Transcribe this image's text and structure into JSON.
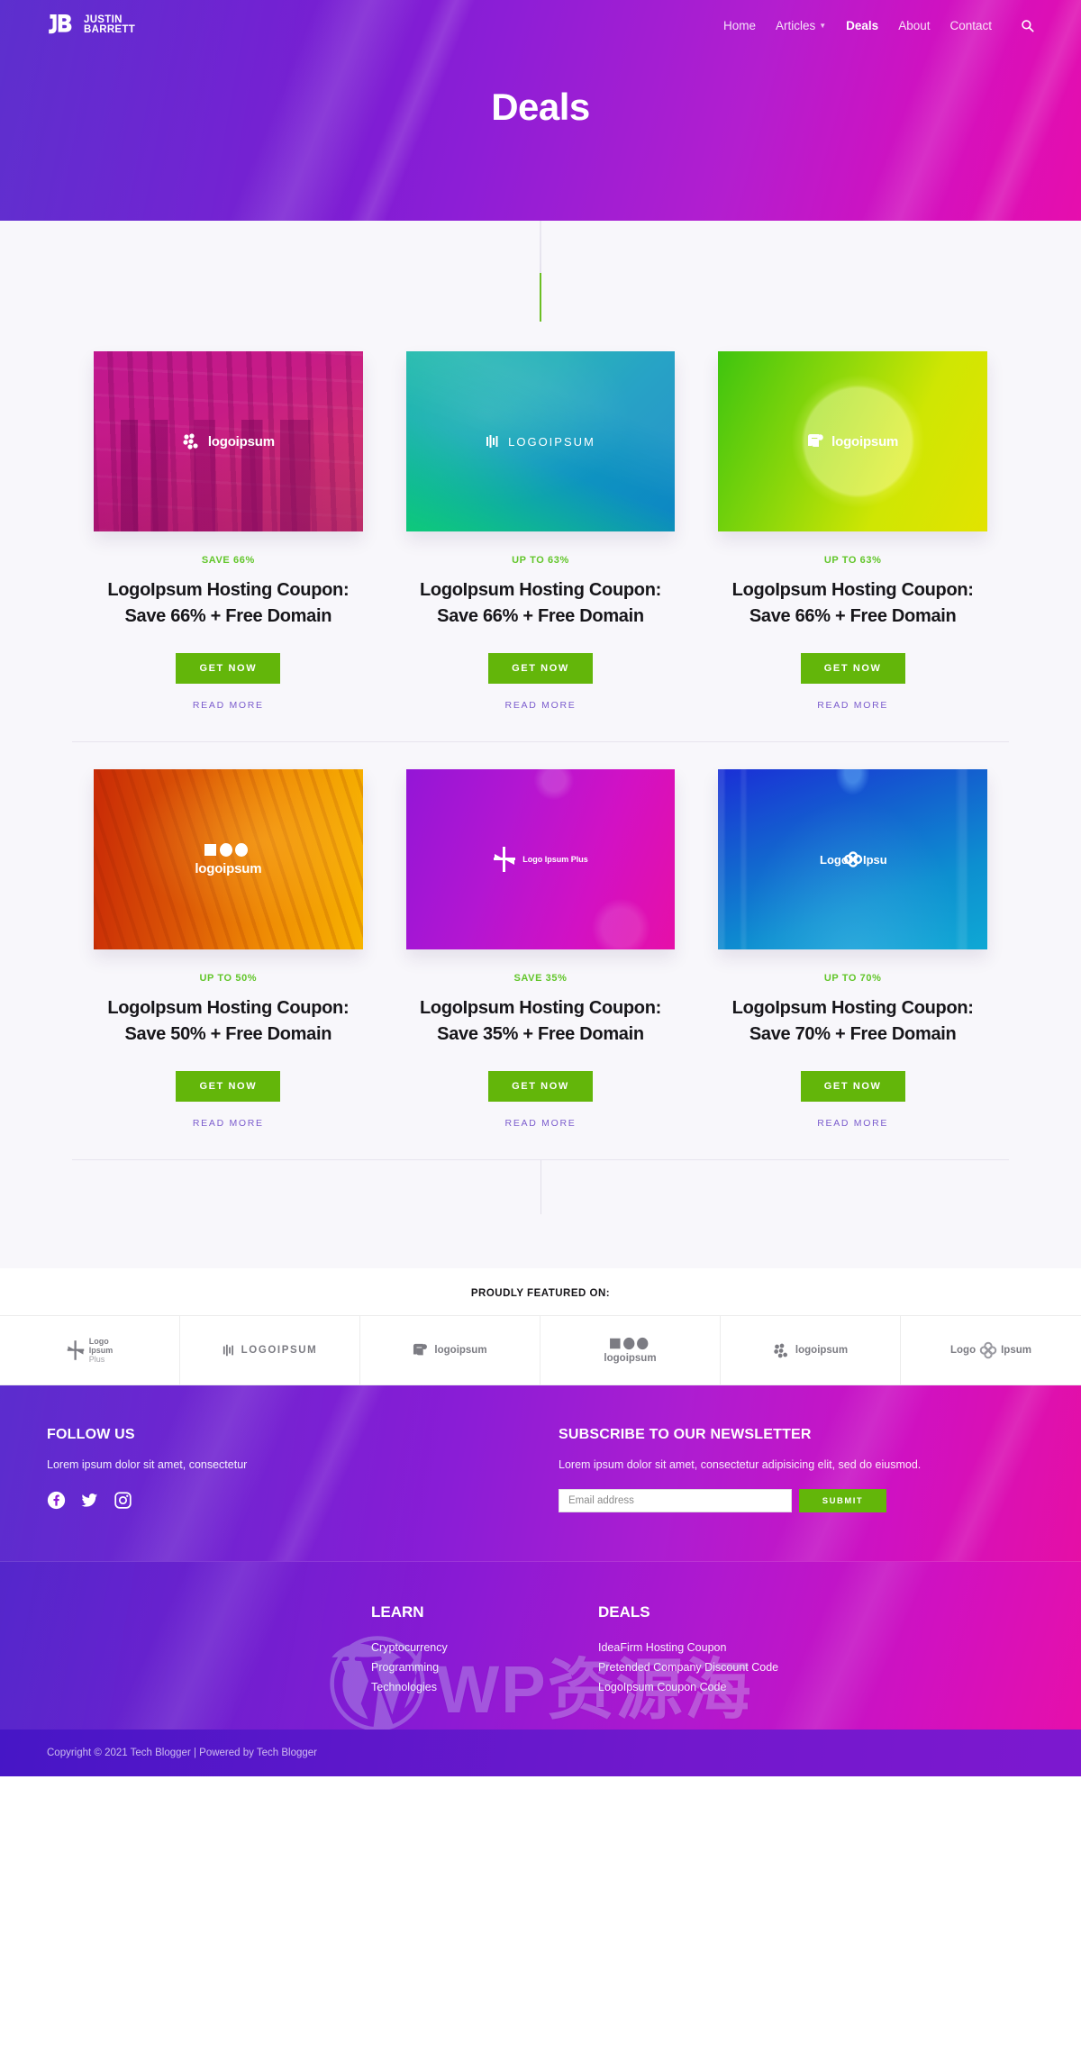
{
  "header": {
    "brand": {
      "mark": "jb-monogram-icon",
      "line1": "JUSTIN",
      "line2": "BARRETT"
    },
    "nav": [
      {
        "label": "Home",
        "active": false,
        "has_caret": false
      },
      {
        "label": "Articles",
        "active": false,
        "has_caret": true
      },
      {
        "label": "Deals",
        "active": true,
        "has_caret": false
      },
      {
        "label": "About",
        "active": false,
        "has_caret": false
      },
      {
        "label": "Contact",
        "active": false,
        "has_caret": false
      }
    ],
    "search_icon": "search-icon",
    "page_title": "Deals"
  },
  "colors": {
    "accent_green": "#63b60a",
    "badge_green": "#62c62a",
    "read_more_purple": "#7b5ccd",
    "brand_purple": "#6a1acf",
    "brand_magenta": "#e60fa6"
  },
  "deals": [
    {
      "badge": "SAVE 66%",
      "title": "LogoIpsum Hosting Coupon: Save 66% + Free Domain",
      "cta": "GET NOW",
      "read_more": "READ MORE",
      "thumb_logo": "logoipsum",
      "thumb_theme": "magenta-city"
    },
    {
      "badge": "UP TO 63%",
      "title": "LogoIpsum Hosting Coupon: Save 66% + Free Domain",
      "cta": "GET NOW",
      "read_more": "READ MORE",
      "thumb_logo": "LOGOIPSUM",
      "thumb_theme": "teal-mountain"
    },
    {
      "badge": "UP TO 63%",
      "title": "LogoIpsum Hosting Coupon: Save 66% + Free Domain",
      "cta": "GET NOW",
      "read_more": "READ MORE",
      "thumb_logo": "logoipsum",
      "thumb_theme": "green-yellow-moon"
    },
    {
      "badge": "UP TO 50%",
      "title": "LogoIpsum Hosting Coupon: Save 50% + Free Domain",
      "cta": "GET NOW",
      "read_more": "READ MORE",
      "thumb_logo": "logoipsum",
      "thumb_theme": "orange-tiger"
    },
    {
      "badge": "SAVE 35%",
      "title": "LogoIpsum Hosting Coupon: Save 35% + Free Domain",
      "cta": "GET NOW",
      "read_more": "READ MORE",
      "thumb_logo": "Logo Ipsum Plus",
      "thumb_theme": "purple-magenta"
    },
    {
      "badge": "UP TO 70%",
      "title": "LogoIpsum Hosting Coupon: Save 70% + Free Domain",
      "cta": "GET NOW",
      "read_more": "READ MORE",
      "thumb_logo": "Logo Ipsum",
      "thumb_theme": "blue-datacenter"
    }
  ],
  "featured": {
    "title": "PROUDLY FEATURED ON:",
    "logos": [
      {
        "name": "logo-ipsum-plus",
        "line1": "Logo",
        "line2": "Ipsum",
        "line3": "Plus"
      },
      {
        "name": "logoipsum-bars",
        "text": "LOGOIPSUM"
      },
      {
        "name": "logoipsum-square",
        "text": "logoipsum"
      },
      {
        "name": "logoipsum-shapes",
        "text": "logoipsum"
      },
      {
        "name": "logoipsum-dots",
        "text": "logoipsum"
      },
      {
        "name": "logo-ipsum-flower",
        "left": "Logo",
        "right": "Ipsum"
      }
    ]
  },
  "footer": {
    "follow": {
      "heading": "FOLLOW US",
      "text": "Lorem ipsum dolor sit amet, consectetur",
      "socials": [
        {
          "name": "facebook-icon"
        },
        {
          "name": "twitter-icon"
        },
        {
          "name": "instagram-icon"
        }
      ]
    },
    "newsletter": {
      "heading": "SUBSCRIBE TO OUR NEWSLETTER",
      "text": "Lorem ipsum dolor sit amet, consectetur adipisicing elit, sed do eiusmod.",
      "email_placeholder": "Email address",
      "email_value": "",
      "submit_label": "SUBMIT"
    },
    "columns": [
      {
        "heading": "LEARN",
        "links": [
          "Cryptocurrency",
          "Programming",
          "Technologies"
        ]
      },
      {
        "heading": "DEALS",
        "links": [
          "IdeaFirm Hosting Coupon",
          "Pretended Company Discount Code",
          "LogoIpsum Coupon Code"
        ]
      }
    ],
    "copyright": "Copyright © 2021 Tech Blogger | Powered by Tech Blogger"
  },
  "watermark": {
    "text": "WP资源海"
  }
}
